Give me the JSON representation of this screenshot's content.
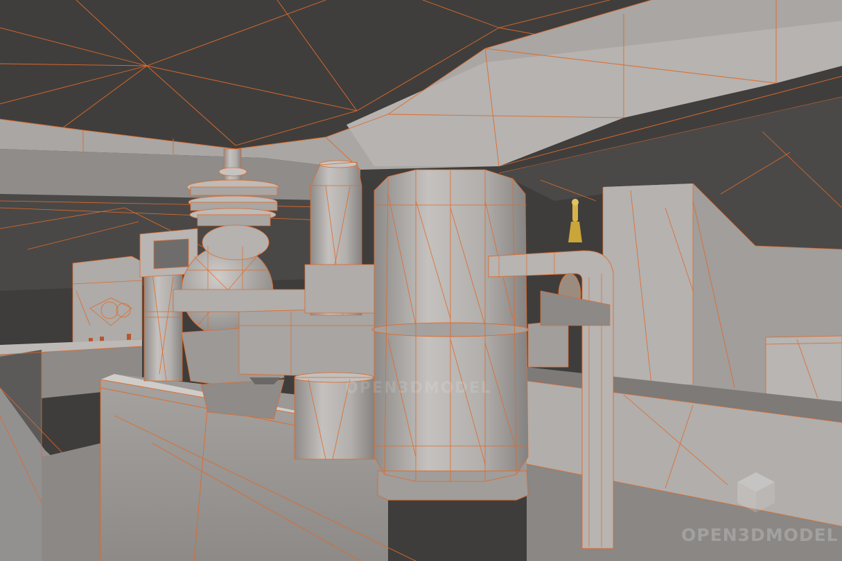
{
  "image": {
    "subject": "3D model viewport render",
    "shading": "grey clay with orange wireframe",
    "palette": {
      "background": "#3f3d3b",
      "surface": "#b3b0ad",
      "wire": "#e06a2a",
      "accent": "#c9a53a"
    }
  },
  "watermark": {
    "text": "OPEN3DMODEL",
    "icon": "cube-logo-icon"
  }
}
